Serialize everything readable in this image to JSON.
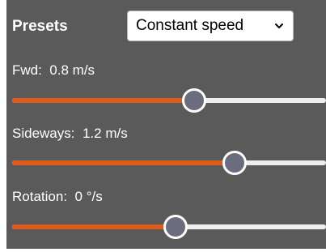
{
  "presets": {
    "title": "Presets",
    "selected": "Constant speed"
  },
  "sliders": [
    {
      "name": "Fwd:",
      "value": "0.8",
      "unit": "m/s",
      "fraction": 0.58
    },
    {
      "name": "Sideways:",
      "value": "1.2",
      "unit": "m/s",
      "fraction": 0.71
    },
    {
      "name": "Rotation:",
      "value": "0",
      "unit": "°/s",
      "fraction": 0.52
    }
  ],
  "colors": {
    "panel": "#5a5a5a",
    "accent": "#e05a1c",
    "thumb": "#6b6d7e",
    "track": "#eeeeee"
  },
  "icons": {
    "select_arrow": "chevron-down-icon"
  }
}
